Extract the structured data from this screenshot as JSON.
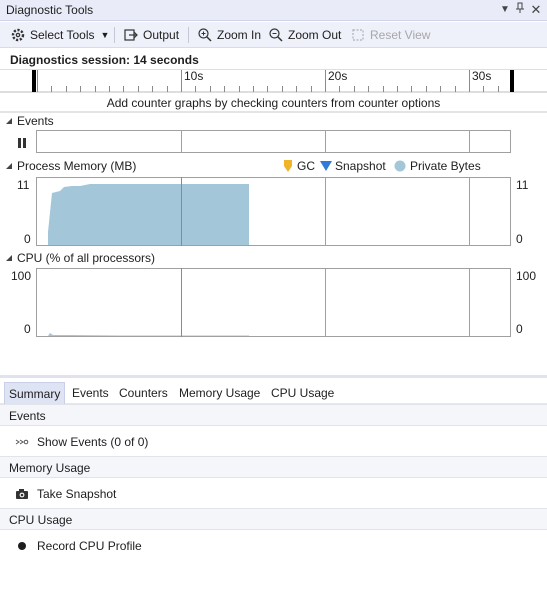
{
  "window": {
    "title": "Diagnostic Tools",
    "dropdown_icon": "chevron-down-icon",
    "pin_icon": "pin-icon",
    "close_icon": "close-icon"
  },
  "toolbar": {
    "select_tools": "Select Tools",
    "output": "Output",
    "zoom_in": "Zoom In",
    "zoom_out": "Zoom Out",
    "reset_view": "Reset View"
  },
  "session": {
    "label": "Diagnostics session: 14 seconds"
  },
  "timeline": {
    "ticks": [
      "10s",
      "20s",
      "30s"
    ]
  },
  "hint": "Add counter graphs by checking counters from counter options",
  "events": {
    "title": "Events"
  },
  "memory": {
    "title": "Process Memory (MB)",
    "y_max": "11",
    "y_min": "0",
    "legend": {
      "gc": "GC",
      "snapshot": "Snapshot",
      "private_bytes": "Private Bytes"
    },
    "colors": {
      "gc": "#f0b429",
      "snapshot": "#2f7bd6",
      "private_bytes": "#a3c6d8"
    }
  },
  "cpu": {
    "title": "CPU (% of all processors)",
    "y_max": "100",
    "y_min": "0"
  },
  "tabs": [
    "Summary",
    "Events",
    "Counters",
    "Memory Usage",
    "CPU Usage"
  ],
  "summary": {
    "events_header": "Events",
    "show_events": "Show Events (0 of 0)",
    "memory_header": "Memory Usage",
    "take_snapshot": "Take Snapshot",
    "cpu_header": "CPU Usage",
    "record_cpu": "Record CPU Profile"
  }
}
